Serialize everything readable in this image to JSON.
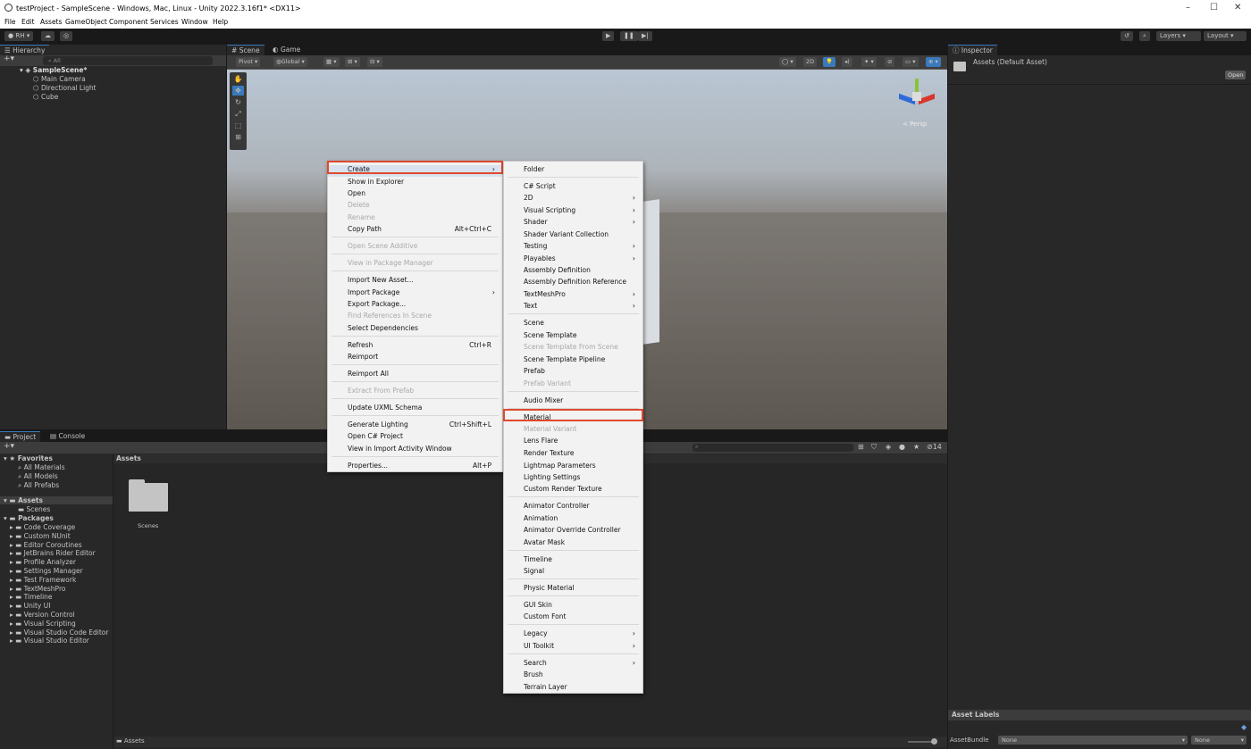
{
  "window": {
    "title": "testProject - SampleScene - Windows, Mac, Linux - Unity 2022.3.16f1* <DX11>",
    "minimize": "–",
    "maximize": "☐",
    "close": "✕"
  },
  "menubar": [
    "File",
    "Edit",
    "Assets",
    "GameObject",
    "Component",
    "Services",
    "Window",
    "Help"
  ],
  "toolbar": {
    "account": "RH",
    "layers": "Layers",
    "layout": "Layout"
  },
  "hierarchy": {
    "tab": "Hierarchy",
    "search_placeholder": "All",
    "scene": "SampleScene*",
    "items": [
      "Main Camera",
      "Directional Light",
      "Cube"
    ]
  },
  "scene_view": {
    "tabs": [
      "Scene",
      "Game"
    ],
    "pivot": "Pivot",
    "global": "Global",
    "mode_2d": "2D",
    "persp": "< Persp"
  },
  "inspector": {
    "tab": "Inspector",
    "asset": "Assets (Default Asset)",
    "open_button": "Open",
    "asset_labels": "Asset Labels",
    "asset_bundle": "AssetBundle",
    "bundle_value": "None",
    "variant_value": "None"
  },
  "project": {
    "tabs": [
      "Project",
      "Console"
    ],
    "favorites": "Favorites",
    "favorite_items": [
      "All Materials",
      "All Models",
      "All Prefabs"
    ],
    "assets": "Assets",
    "asset_children": [
      "Scenes"
    ],
    "packages": "Packages",
    "package_items": [
      "Code Coverage",
      "Custom NUnit",
      "Editor Coroutines",
      "JetBrains Rider Editor",
      "Profile Analyzer",
      "Settings Manager",
      "Test Framework",
      "TextMeshPro",
      "Timeline",
      "Unity UI",
      "Version Control",
      "Visual Scripting",
      "Visual Studio Code Editor",
      "Visual Studio Editor"
    ],
    "breadcrumb": "Assets",
    "folder_label": "Scenes",
    "footer_path": "Assets",
    "hidden_count": "14"
  },
  "context_menu": {
    "items": [
      {
        "label": "Create",
        "arrow": true
      },
      {
        "label": "Show in Explorer"
      },
      {
        "label": "Open"
      },
      {
        "label": "Delete",
        "disabled": true
      },
      {
        "label": "Rename",
        "disabled": true
      },
      {
        "label": "Copy Path",
        "shortcut": "Alt+Ctrl+C"
      },
      {
        "label": "Open Scene Additive",
        "disabled": true
      },
      {
        "label": "View in Package Manager",
        "disabled": true
      },
      {
        "label": "Import New Asset..."
      },
      {
        "label": "Import Package",
        "arrow": true
      },
      {
        "label": "Export Package..."
      },
      {
        "label": "Find References In Scene",
        "disabled": true
      },
      {
        "label": "Select Dependencies"
      },
      {
        "label": "Refresh",
        "shortcut": "Ctrl+R"
      },
      {
        "label": "Reimport"
      },
      {
        "label": "Reimport All"
      },
      {
        "label": "Extract From Prefab",
        "disabled": true
      },
      {
        "label": "Update UXML Schema"
      },
      {
        "label": "Generate Lighting",
        "shortcut": "Ctrl+Shift+L"
      },
      {
        "label": "Open C# Project"
      },
      {
        "label": "View in Import Activity Window"
      },
      {
        "label": "Properties...",
        "shortcut": "Alt+P"
      }
    ]
  },
  "create_submenu": {
    "items": [
      {
        "label": "Folder"
      },
      {
        "label": "C# Script"
      },
      {
        "label": "2D",
        "arrow": true
      },
      {
        "label": "Visual Scripting",
        "arrow": true
      },
      {
        "label": "Shader",
        "arrow": true
      },
      {
        "label": "Shader Variant Collection"
      },
      {
        "label": "Testing",
        "arrow": true
      },
      {
        "label": "Playables",
        "arrow": true
      },
      {
        "label": "Assembly Definition"
      },
      {
        "label": "Assembly Definition Reference"
      },
      {
        "label": "TextMeshPro",
        "arrow": true
      },
      {
        "label": "Text",
        "arrow": true
      },
      {
        "label": "Scene"
      },
      {
        "label": "Scene Template"
      },
      {
        "label": "Scene Template From Scene",
        "disabled": true
      },
      {
        "label": "Scene Template Pipeline"
      },
      {
        "label": "Prefab"
      },
      {
        "label": "Prefab Variant",
        "disabled": true
      },
      {
        "label": "Audio Mixer"
      },
      {
        "label": "Material"
      },
      {
        "label": "Material Variant",
        "disabled": true
      },
      {
        "label": "Lens Flare"
      },
      {
        "label": "Render Texture"
      },
      {
        "label": "Lightmap Parameters"
      },
      {
        "label": "Lighting Settings"
      },
      {
        "label": "Custom Render Texture"
      },
      {
        "label": "Animator Controller"
      },
      {
        "label": "Animation"
      },
      {
        "label": "Animator Override Controller"
      },
      {
        "label": "Avatar Mask"
      },
      {
        "label": "Timeline"
      },
      {
        "label": "Signal"
      },
      {
        "label": "Physic Material"
      },
      {
        "label": "GUI Skin"
      },
      {
        "label": "Custom Font"
      },
      {
        "label": "Legacy",
        "arrow": true
      },
      {
        "label": "UI Toolkit",
        "arrow": true
      },
      {
        "label": "Search",
        "arrow": true
      },
      {
        "label": "Brush"
      },
      {
        "label": "Terrain Layer"
      }
    ]
  },
  "colors": {
    "highlight": "#e0492d",
    "menu_bg": "#f2f2f2",
    "panel_bg": "#282828",
    "accent": "#3a79bb"
  }
}
